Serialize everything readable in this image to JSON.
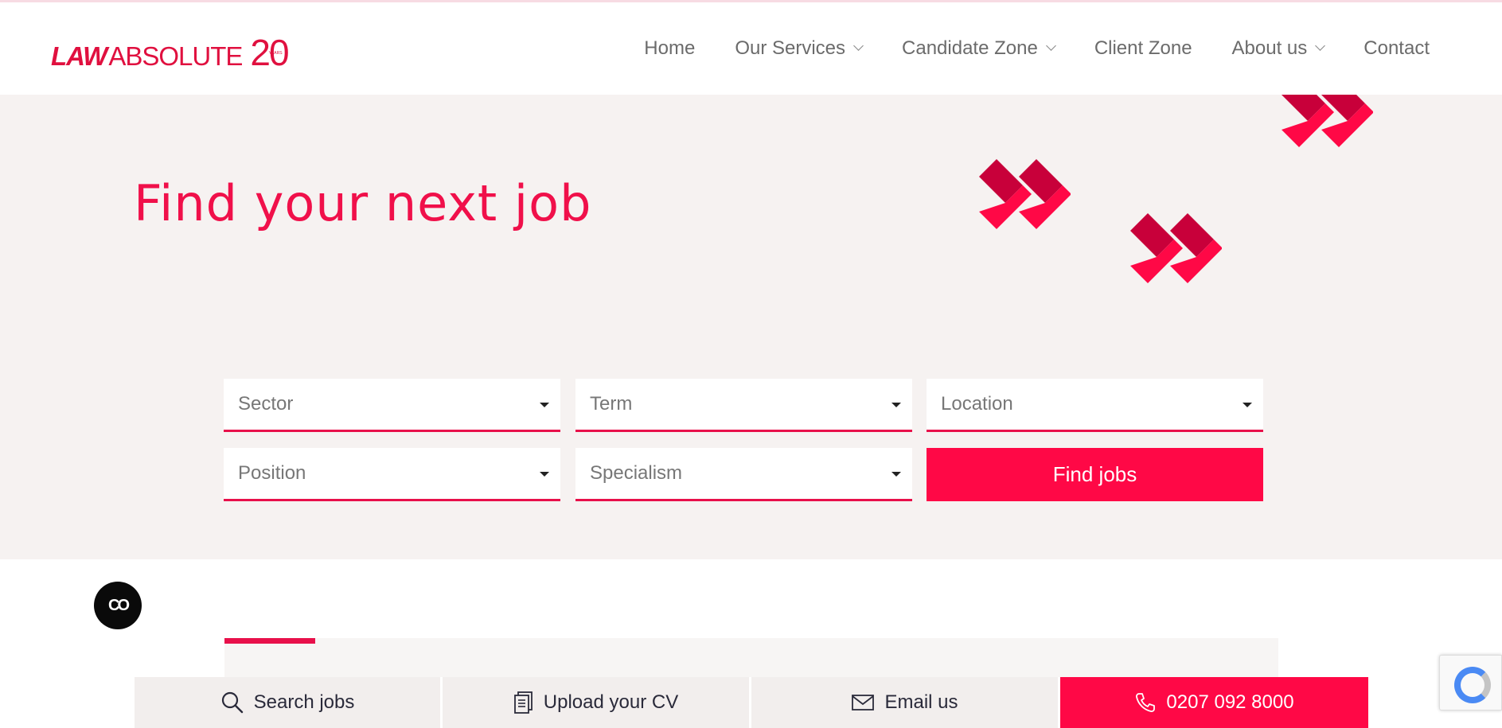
{
  "brand": {
    "logo_law": "LAW",
    "logo_absolute": "ABSOLUTE",
    "logo_twenty": "20",
    "logo_years": "YEARS",
    "accent_color": "#e8104a",
    "button_color": "#ff0846"
  },
  "nav": {
    "items": [
      {
        "label": "Home",
        "has_dropdown": false
      },
      {
        "label": "Our Services",
        "has_dropdown": true
      },
      {
        "label": "Candidate Zone",
        "has_dropdown": true
      },
      {
        "label": "Client Zone",
        "has_dropdown": false
      },
      {
        "label": "About us",
        "has_dropdown": true
      },
      {
        "label": "Contact",
        "has_dropdown": false
      }
    ]
  },
  "hero": {
    "title": "Find your next job",
    "filters": {
      "sector": "Sector",
      "term": "Term",
      "location": "Location",
      "position": "Position",
      "specialism": "Specialism"
    },
    "find_button": "Find jobs"
  },
  "floating": {
    "badge_text": "CO"
  },
  "bottom_bar": {
    "search_jobs": "Search jobs",
    "upload_cv": "Upload your CV",
    "email_us": "Email us",
    "phone": "0207 092 8000"
  },
  "icons": [
    "search-icon",
    "document-icon",
    "envelope-icon",
    "phone-icon",
    "chevron-down-icon",
    "caret-down-icon"
  ]
}
